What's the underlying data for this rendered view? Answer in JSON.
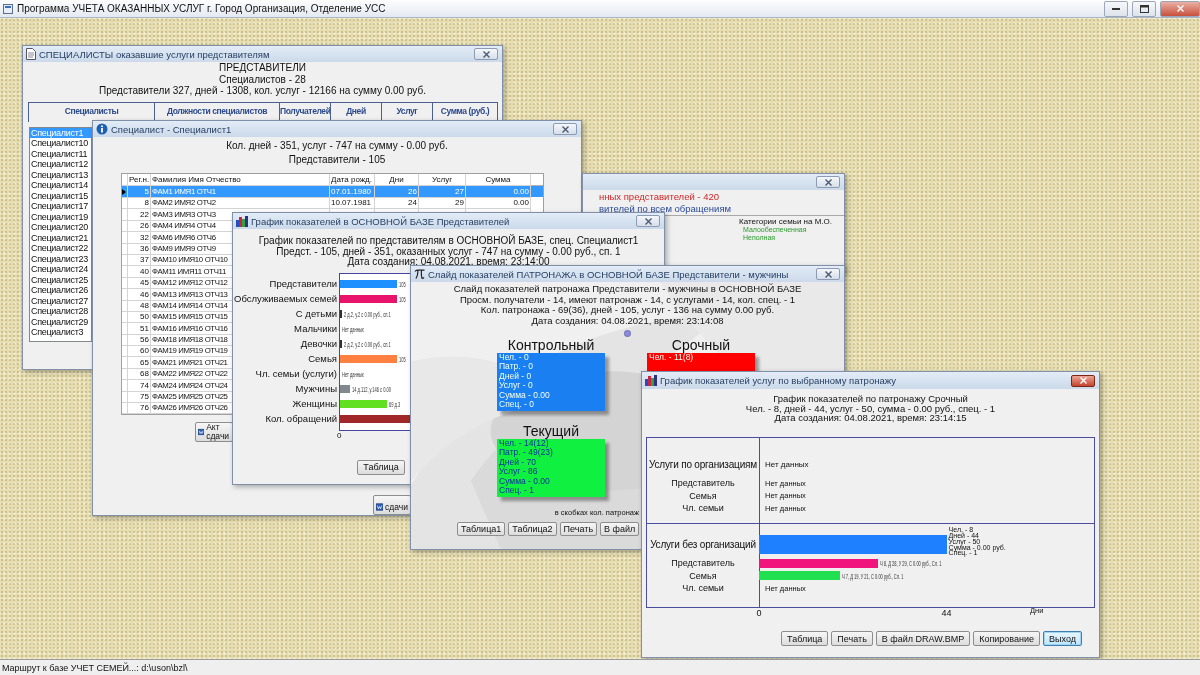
{
  "app_title": "Программа УЧЕТА ОКАЗАННЫХ УСЛУГ г. Город Организация, Отделение УСС",
  "windows": [
    {
      "kind": "specialists",
      "title": "СПЕЦИАЛИСТЫ оказавшие услуги представителям",
      "lines": [
        "ПРЕДСТАВИТЕЛИ",
        "Специалистов - 28",
        "Представители 327, дней - 1308, кол. услуг - 12166 на сумму 0.00 руб."
      ],
      "columns": [
        "Специалисты",
        "Должности специалистов",
        "Получателей",
        "Дней",
        "Услуг",
        "Сумма (руб.)"
      ],
      "items": [
        {
          "label": "Специалист1",
          "selected": true
        },
        {
          "label": "Специалист10",
          "selected": false
        },
        {
          "label": "Специалист11",
          "selected": false
        },
        {
          "label": "Специалист12",
          "selected": false
        },
        {
          "label": "Специалист13",
          "selected": false
        },
        {
          "label": "Специалист14",
          "selected": false
        },
        {
          "label": "Специалист15",
          "selected": false
        },
        {
          "label": "Специалист17",
          "selected": false
        },
        {
          "label": "Специалист19",
          "selected": false
        },
        {
          "label": "Специалист20",
          "selected": false
        },
        {
          "label": "Специалист21",
          "selected": false
        },
        {
          "label": "Специалист22",
          "selected": false
        },
        {
          "label": "Специалист23",
          "selected": false
        },
        {
          "label": "Специалист24",
          "selected": false
        },
        {
          "label": "Специалист25",
          "selected": false
        },
        {
          "label": "Специалист26",
          "selected": false
        },
        {
          "label": "Специалист27",
          "selected": false
        },
        {
          "label": "Специалист28",
          "selected": false
        },
        {
          "label": "Специалист29",
          "selected": false
        },
        {
          "label": "Специалист3",
          "selected": false
        }
      ]
    },
    {
      "kind": "specialist",
      "title": "Специалист - Специалист1",
      "lines": [
        "Кол. дней - 351, услуг - 747 на сумму - 0.00 руб.",
        "Представители - 105"
      ],
      "columns": [
        "Рег.н.",
        "Фамилия Имя Отчество",
        "Дата рожд.",
        "Дни",
        "Услуг",
        "Сумма"
      ],
      "rows": [
        {
          "cells": [
            "5",
            "ФАМ1 ИМЯ1 ОТЧ1",
            "07.01.1980",
            "26",
            "27",
            "0.00"
          ],
          "selected": true
        },
        {
          "cells": [
            "8",
            "ФАМ2 ИМЯ2 ОТЧ2",
            "10.07.1981",
            "24",
            "29",
            "0.00"
          ],
          "selected": false
        },
        {
          "cells": [
            "22",
            "ФАМ3 ИМЯ3 ОТЧ3"
          ],
          "selected": false
        },
        {
          "cells": [
            "26",
            "ФАМ4 ИМЯ4 ОТЧ4"
          ],
          "selected": false
        },
        {
          "cells": [
            "32",
            "ФАМ6 ИМЯ6 ОТЧ6"
          ],
          "selected": false
        },
        {
          "cells": [
            "36",
            "ФАМ9 ИМЯ9 ОТЧ9"
          ],
          "selected": false
        },
        {
          "cells": [
            "37",
            "ФАМ10 ИМЯ10 ОТЧ10"
          ],
          "selected": false
        },
        {
          "cells": [
            "40",
            "ФАМ11 ИМЯ11 ОТЧ11"
          ],
          "selected": false
        },
        {
          "cells": [
            "45",
            "ФАМ12 ИМЯ12 ОТЧ12"
          ],
          "selected": false
        },
        {
          "cells": [
            "46",
            "ФАМ13 ИМЯ13 ОТЧ13"
          ],
          "selected": false
        },
        {
          "cells": [
            "48",
            "ФАМ14 ИМЯ14 ОТЧ14"
          ],
          "selected": false
        },
        {
          "cells": [
            "50",
            "ФАМ15 ИМЯ15 ОТЧ15"
          ],
          "selected": false
        },
        {
          "cells": [
            "51",
            "ФАМ16 ИМЯ16 ОТЧ16"
          ],
          "selected": false
        },
        {
          "cells": [
            "56",
            "ФАМ18 ИМЯ18 ОТЧ18"
          ],
          "selected": false
        },
        {
          "cells": [
            "60",
            "ФАМ19 ИМЯ19 ОТЧ19"
          ],
          "selected": false
        },
        {
          "cells": [
            "65",
            "ФАМ21 ИМЯ21 ОТЧ21"
          ],
          "selected": false
        },
        {
          "cells": [
            "68",
            "ФАМ22 ИМЯ22 ОТЧ22"
          ],
          "selected": false
        },
        {
          "cells": [
            "74",
            "ФАМ24 ИМЯ24 ОТЧ24"
          ],
          "selected": false
        },
        {
          "cells": [
            "75",
            "ФАМ25 ИМЯ25 ОТЧ25"
          ],
          "selected": false
        },
        {
          "cells": [
            "76",
            "ФАМ26 ИМЯ26 ОТЧ26"
          ],
          "selected": false
        }
      ],
      "buttons": [
        "Акт сдачи",
        "сдачи"
      ]
    },
    {
      "kind": "summary",
      "lines": [
        "нных представителей - 420",
        "вителей по всем обращениям"
      ],
      "legend_title": "Категории семьи на М.О.",
      "legend": [
        "Малообеспеченная",
        "Неполная"
      ]
    },
    {
      "kind": "chart",
      "title": "График показателей в ОСНОВНОЙ БАЗЕ Представителей",
      "lines": [
        "График показателей по представителям в ОСНОВНОЙ БАЗЕ, спец. Специалист1",
        "Предст. - 105, дней - 351, оказанных услуг - 747 на сумму - 0.00 руб., сп. 1",
        "Дата создания: 04.08.2021, время: 23:14:00"
      ],
      "bars": [
        {
          "label": "Представители",
          "level": 0.81,
          "color": "#1e90ff",
          "value_label": "105"
        },
        {
          "label": "Обслуживаемых семей",
          "level": 0.81,
          "color": "#e8146c",
          "value_label": "105"
        },
        {
          "label": "С детьми",
          "level": 0.03,
          "color": "#303030",
          "value_label": "2 д.2, у.2 с 0.00 руб., сп.1"
        },
        {
          "label": "Мальчики",
          "value_label": "Нет данных"
        },
        {
          "label": "Девочки",
          "level": 0.03,
          "color": "#303030",
          "value_label": "2 д.2, у.2 с 0.00 руб., сп.1"
        },
        {
          "label": "Семья",
          "level": 0.81,
          "color": "#ff8040",
          "value_label": "105"
        },
        {
          "label": "Чл. семьи (услуги)",
          "value_label": "Нет данных"
        },
        {
          "label": "Мужчины",
          "level": 0.14,
          "color": "#808890",
          "value_label": "14 д.112, у.146 с 0.00"
        },
        {
          "label": "Женщины",
          "level": 0.67,
          "color": "#60e020",
          "value_label": "69 д.3"
        },
        {
          "label": "Кол. обращений",
          "level": 1,
          "color": "#a02828"
        }
      ],
      "axis_tick": "0",
      "buttons": [
        "Таблица"
      ]
    },
    {
      "kind": "slide",
      "title": "Слайд показателей ПАТРОНАЖА в ОСНОВНОЙ БАЗЕ Представители - мужчины",
      "lines": [
        "Слайд показателей патронажа Представители - мужчины в ОСНОВНОЙ БАЗЕ",
        "Просм. получатели - 14, имеют патронаж - 14, с услугами - 14, кол. спец. - 1",
        "Кол. патронажа - 69(36), дней - 105, услуг - 136 на сумму 0.00 руб.",
        "Дата создания: 04.08.2021, время: 23:14:08"
      ],
      "groups": [
        {
          "title": "Контрольный",
          "color": "#1a7ff0",
          "lines": [
            "Чел. - 0",
            "Патр. - 0",
            "Дней - 0",
            "Услуг - 0",
            "Сумма - 0.00",
            "Спец. - 0"
          ]
        },
        {
          "title": "Срочный",
          "color": "#ff0000",
          "lines": [
            "Чел. - 11(8)"
          ]
        },
        {
          "title": "Текущий",
          "color": "#10f040",
          "lines": [
            "Чел. - 14(12)",
            "Патр. - 49(23)",
            "Дней - 70",
            "Услуг - 86",
            "Сумма - 0.00",
            "Спец. - 1"
          ]
        }
      ],
      "note": "в скобках кол. патронаж",
      "buttons": [
        "Таблица1",
        "Таблица2",
        "Печать",
        "В файл"
      ]
    },
    {
      "kind": "service_chart",
      "title": "График показателей услуг по выбранному патронажу",
      "lines": [
        "График показателей по патронажу Срочный",
        "Чел. - 8, дней - 44, услуг - 50, сумма - 0.00 руб., спец. - 1",
        "Дата создания: 04.08.2021, время: 23:14:15"
      ],
      "sections": [
        {
          "title": "Услуги по организациям",
          "head": {
            "value_label": "Нет данных"
          },
          "rows": [
            {
              "label": "Представитель",
              "value_label": "Нет данных"
            },
            {
              "label": "Семья",
              "value_label": "Нет данных"
            },
            {
              "label": "Чл. семьи",
              "value_label": "Нет данных"
            }
          ]
        },
        {
          "title": "Услуги без организаций",
          "head": {
            "level": 0.56,
            "color": "#1e80ff",
            "value_lines": [
              "Чел. - 8",
              "Дней - 44",
              "Услуг - 50",
              "Сумма - 0.00 руб.",
              "Спец. - 1"
            ]
          },
          "rows": [
            {
              "label": "Представитель",
              "level": 0.356,
              "color": "#f0147c",
              "value_label": "Ч 8, Д 28, У 29, С 0.00 руб., Сл. 1"
            },
            {
              "label": "Семья",
              "level": 0.243,
              "color": "#20e050",
              "value_label": "Ч 7, Д 19, У 21, С 0.00 руб., Сл. 1"
            },
            {
              "label": "Чл. семьи",
              "value_label": "Нет данных"
            }
          ]
        }
      ],
      "ticks": [
        "0",
        "44"
      ],
      "axis_unit": "Дни",
      "buttons": [
        {
          "label": "Таблица",
          "focused": false
        },
        {
          "label": "Печать",
          "focused": false
        },
        {
          "label": "В файл DRAW.BMP",
          "focused": false
        },
        {
          "label": "Копирование",
          "focused": false
        },
        {
          "label": "Выход",
          "focused": true
        }
      ]
    }
  ],
  "status_bar": "Маршрут к базе УЧЕТ СЕМЕЙ...: d:\\uson\\bzl\\"
}
